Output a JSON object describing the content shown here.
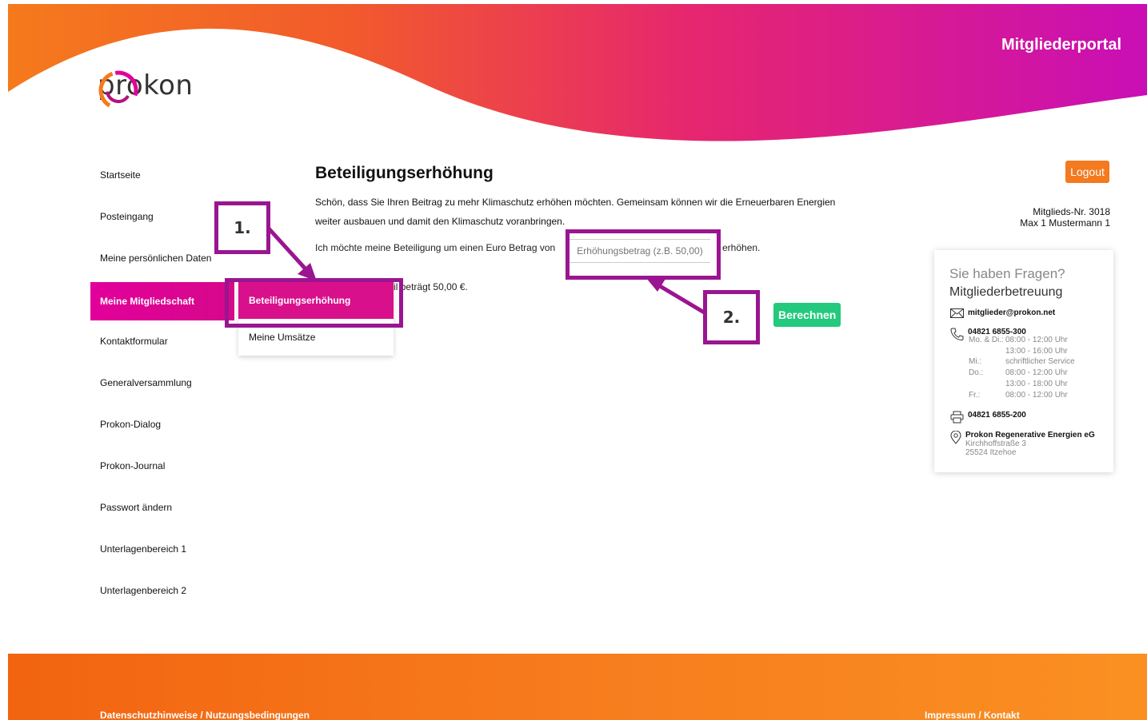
{
  "header": {
    "portal_title": "Mitgliederportal",
    "logo_text": "prokon"
  },
  "sidebar": {
    "items": [
      {
        "label": "Startseite"
      },
      {
        "label": "Posteingang"
      },
      {
        "label": "Meine persönlichen Daten"
      },
      {
        "label": "Meine Mitgliedschaft",
        "active": true
      },
      {
        "label": "Kontaktformular"
      },
      {
        "label": "Generalversammlung"
      },
      {
        "label": "Prokon-Dialog"
      },
      {
        "label": "Prokon-Journal"
      },
      {
        "label": "Passwort ändern"
      },
      {
        "label": "Unterlagenbereich 1"
      },
      {
        "label": "Unterlagenbereich 2"
      }
    ],
    "submenu": [
      {
        "label": "Beteiligungserhöhung",
        "active": true
      },
      {
        "label": "Meine Umsätze"
      }
    ]
  },
  "main": {
    "title": "Beteiligungserhöhung",
    "intro": "Schön, dass Sie Ihren Beitrag zu mehr Klimaschutz erhöhen möchten. Gemeinsam können wir die Erneuerbaren Energien weiter ausbauen und damit den Klimaschutz voranbringen.",
    "amount_prefix": "Ich möchte meine Beteiligung um einen Euro Betrag von",
    "amount_placeholder": "Erhöhungsbetrag (z.B. 50,00)",
    "amount_suffix": "erhöhen.",
    "share_note": "Ein Geschäftsanteil beträgt 50,00 €.",
    "calculate_label": "Berechnen"
  },
  "account": {
    "logout_label": "Logout",
    "member_number": "Mitglieds-Nr. 3018",
    "member_name": "Max 1 Mustermann 1"
  },
  "help": {
    "title": "Sie haben Fragen?",
    "subtitle": "Mitgliederbetreuung",
    "email": "mitglieder@prokon.net",
    "phone": "04821 6855-300",
    "hours": [
      {
        "day": "Mo. & Di.:",
        "time": "08:00 - 12:00 Uhr"
      },
      {
        "day": "",
        "time": "13:00 - 16:00 Uhr"
      },
      {
        "day": "Mi.:",
        "time": "schriftlicher Service"
      },
      {
        "day": "Do.:",
        "time": "08:00 - 12:00 Uhr"
      },
      {
        "day": "",
        "time": "13:00 - 18:00 Uhr"
      },
      {
        "day": "Fr.:",
        "time": "08:00 - 12:00 Uhr"
      }
    ],
    "fax": "04821 6855-200",
    "company": "Prokon Regenerative Energien eG",
    "street": "Kirchhoffstraße 3",
    "city": "25524 Itzehoe"
  },
  "footer": {
    "left_link": "Datenschutzhinweise / Nutzungsbedingungen",
    "right_link": "Impressum / Kontakt"
  },
  "annotations": {
    "step1": "1.",
    "step2": "2.",
    "color": "#9a1590"
  },
  "colors": {
    "brand_magenta": "#e2009b",
    "brand_orange": "#f37a1f",
    "button_green": "#23c97c"
  }
}
